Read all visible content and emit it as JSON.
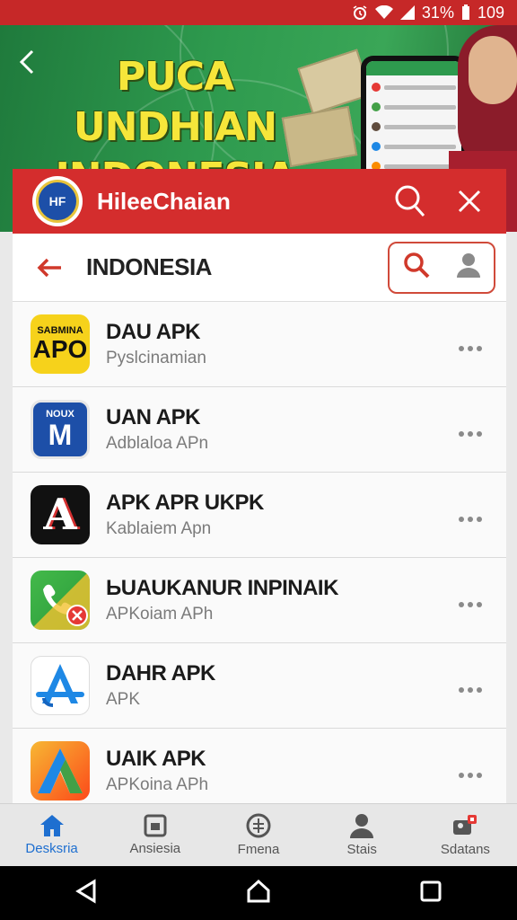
{
  "status_bar": {
    "battery": "31%",
    "time": "109"
  },
  "banner": {
    "title": "PUCA UNDHIAN INDONESIA"
  },
  "app_header": {
    "title": "HileeChaian",
    "logo_text": "HF"
  },
  "search_bar": {
    "title": "INDONESIA"
  },
  "apps": [
    {
      "title": "DAU APK",
      "subtitle": "Pyslcinamian",
      "icon": "sabmina-apo-icon",
      "icon_text_top": "SABMINA",
      "icon_text_bottom": "APO"
    },
    {
      "title": "UAN APK",
      "subtitle": "Adblaloa APn",
      "icon": "nous-m-icon",
      "icon_text_top": "NOUX",
      "icon_text_bottom": "M"
    },
    {
      "title": "APK APR UKPK",
      "subtitle": "Kablaiem Apn",
      "icon": "letter-a-icon",
      "icon_text_bottom": "A"
    },
    {
      "title": "ЬUAUKANUR INPINAIK",
      "subtitle": "APKoiam APh",
      "icon": "phone-call-icon"
    },
    {
      "title": "DAHR APK",
      "subtitle": "APK",
      "icon": "app-store-icon"
    },
    {
      "title": "UAIK APK",
      "subtitle": "APKoina APh",
      "icon": "colorful-a-icon"
    }
  ],
  "bottom_nav": [
    {
      "label": "Desksria",
      "icon": "home-icon",
      "active": true
    },
    {
      "label": "Ansiesia",
      "icon": "square-icon",
      "active": false
    },
    {
      "label": "Fmena",
      "icon": "compass-icon",
      "active": false
    },
    {
      "label": "Stais",
      "icon": "person-icon",
      "active": false
    },
    {
      "label": "Sdatans",
      "icon": "profile-badge-icon",
      "active": false
    }
  ],
  "colors": {
    "primary": "#d42d2d",
    "active_nav": "#1e6fd0",
    "banner_green": "#2e9a4e",
    "banner_text": "#f6e63a"
  }
}
